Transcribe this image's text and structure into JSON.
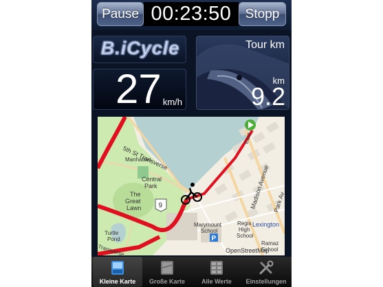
{
  "controls": {
    "pause_label": "Pause",
    "timer": "00:23:50",
    "stop_label": "Stopp"
  },
  "logo": {
    "text": "B.iCycle"
  },
  "speed": {
    "value": "27",
    "unit": "km/h"
  },
  "tour": {
    "title": "Tour km",
    "unit": "km",
    "value": "9.2"
  },
  "map": {
    "labels": {
      "street_1": "5th St Transverse",
      "manhattan": "Manhattan",
      "central_park_1": "Central",
      "central_park_2": "Park",
      "great_lawn_1": "The",
      "great_lawn_2": "Great",
      "great_lawn_3": "Lawn",
      "route_badge": "9",
      "marymount_1": "Marymount",
      "marymount_2": "School",
      "regis_1": "Regis",
      "regis_2": "High",
      "regis_3": "School",
      "ramaz_1": "Ramaz",
      "ramaz_2": "School",
      "madison": "Madison Avenue",
      "park_ave": "Park Av",
      "lexington": "Lexington",
      "east": "East",
      "turtle_pond_1": "Turtle",
      "turtle_pond_2": "Pond",
      "transverse_2": "Transverse",
      "attribution": "OpenStreetMap"
    },
    "colors": {
      "land": "#f2eee4",
      "park": "#cdebb0",
      "water": "#b5d0d0",
      "route": "#e01020",
      "start_flag": "#4caf3a"
    }
  },
  "tabs": [
    {
      "label": "Kleine Karte",
      "icon": "small-map-icon",
      "active": true
    },
    {
      "label": "Große Karte",
      "icon": "large-map-icon",
      "active": false
    },
    {
      "label": "Alle Werte",
      "icon": "all-values-icon",
      "active": false
    },
    {
      "label": "Einstellungen",
      "icon": "settings-icon",
      "active": false
    }
  ]
}
